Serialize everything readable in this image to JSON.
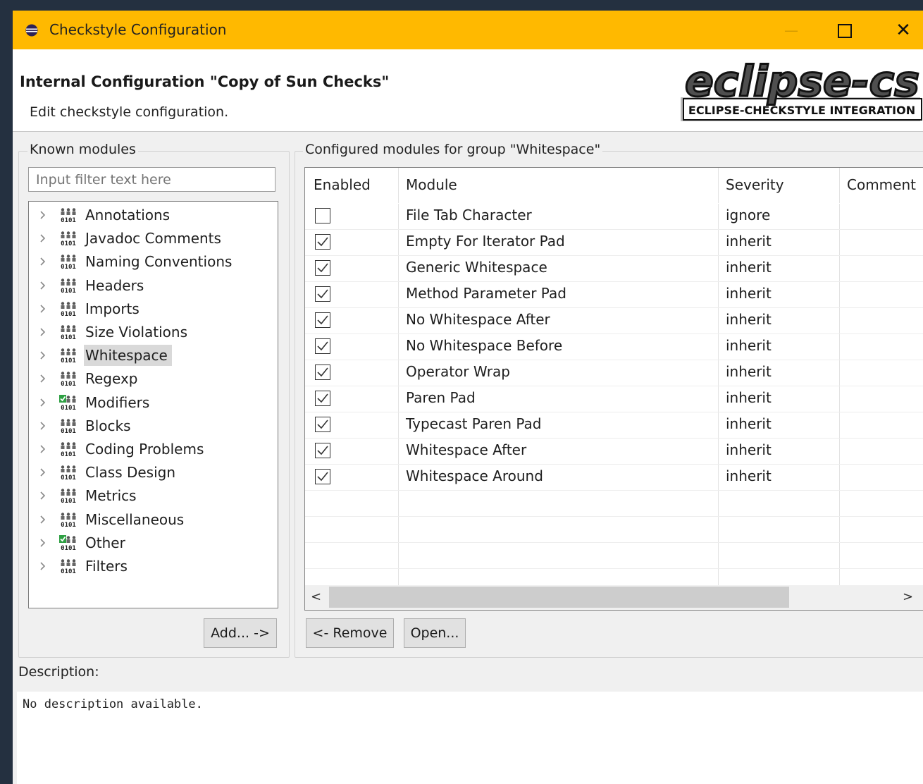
{
  "window": {
    "title": "Checkstyle Configuration",
    "controls": [
      "minimize-icon",
      "maximize-icon",
      "close-icon"
    ],
    "titlebar_color": "#ffb900"
  },
  "header": {
    "title": "Internal Configuration \"Copy of Sun Checks\"",
    "subtitle": "Edit checkstyle configuration.",
    "logo_text": "eclipse-cs",
    "logo_tagline": "ECLIPSE-CHECKSTYLE INTEGRATION"
  },
  "known_modules": {
    "label": "Known modules",
    "filter_placeholder": "Input filter text here",
    "items": [
      {
        "label": "Annotations",
        "icon": "module-icon",
        "selected": false
      },
      {
        "label": "Javadoc Comments",
        "icon": "module-icon",
        "selected": false
      },
      {
        "label": "Naming Conventions",
        "icon": "module-icon",
        "selected": false
      },
      {
        "label": "Headers",
        "icon": "module-icon",
        "selected": false
      },
      {
        "label": "Imports",
        "icon": "module-icon",
        "selected": false
      },
      {
        "label": "Size Violations",
        "icon": "module-icon",
        "selected": false
      },
      {
        "label": "Whitespace",
        "icon": "module-icon",
        "selected": true
      },
      {
        "label": "Regexp",
        "icon": "module-icon",
        "selected": false
      },
      {
        "label": "Modifiers",
        "icon": "module-checked-icon",
        "selected": false
      },
      {
        "label": "Blocks",
        "icon": "module-icon",
        "selected": false
      },
      {
        "label": "Coding Problems",
        "icon": "module-icon",
        "selected": false
      },
      {
        "label": "Class Design",
        "icon": "module-icon",
        "selected": false
      },
      {
        "label": "Metrics",
        "icon": "module-icon",
        "selected": false
      },
      {
        "label": "Miscellaneous",
        "icon": "module-icon",
        "selected": false
      },
      {
        "label": "Other",
        "icon": "module-checked-icon",
        "selected": false
      },
      {
        "label": "Filters",
        "icon": "module-icon",
        "selected": false
      }
    ],
    "add_button": "Add... ->"
  },
  "configured": {
    "label": "Configured modules for group \"Whitespace\"",
    "columns": [
      "Enabled",
      "Module",
      "Severity",
      "Comment"
    ],
    "rows": [
      {
        "enabled": false,
        "module": "File Tab Character",
        "severity": "ignore"
      },
      {
        "enabled": true,
        "module": "Empty For Iterator Pad",
        "severity": "inherit"
      },
      {
        "enabled": true,
        "module": "Generic Whitespace",
        "severity": "inherit"
      },
      {
        "enabled": true,
        "module": "Method Parameter Pad",
        "severity": "inherit"
      },
      {
        "enabled": true,
        "module": "No Whitespace After",
        "severity": "inherit"
      },
      {
        "enabled": true,
        "module": "No Whitespace Before",
        "severity": "inherit"
      },
      {
        "enabled": true,
        "module": "Operator Wrap",
        "severity": "inherit"
      },
      {
        "enabled": true,
        "module": "Paren Pad",
        "severity": "inherit"
      },
      {
        "enabled": true,
        "module": "Typecast Paren Pad",
        "severity": "inherit"
      },
      {
        "enabled": true,
        "module": "Whitespace After",
        "severity": "inherit"
      },
      {
        "enabled": true,
        "module": "Whitespace Around",
        "severity": "inherit"
      }
    ],
    "remove_button": "<- Remove",
    "open_button": "Open..."
  },
  "description": {
    "label": "Description:",
    "text": "No description available."
  }
}
